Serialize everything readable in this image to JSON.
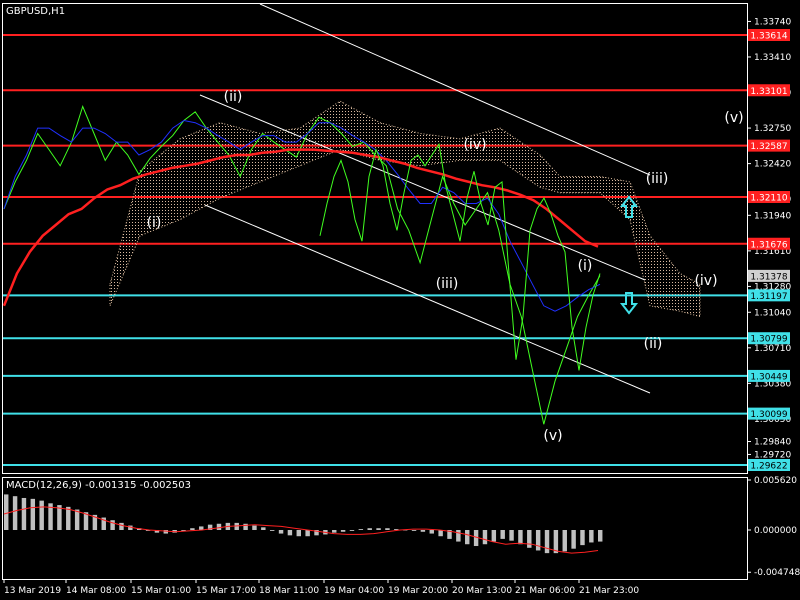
{
  "window": {
    "title": "GBPUSD,H1"
  },
  "chart_data": [
    {
      "type": "line",
      "title": "GBPUSD,H1",
      "ylim": [
        1.2962,
        1.3385
      ],
      "y_ticks": [
        "1.33740",
        "1.33410",
        "1.33080",
        "1.32750",
        "1.32420",
        "1.32090",
        "1.31940",
        "1.31610",
        "1.31280",
        "1.31040",
        "1.30710",
        "1.30380",
        "1.30050",
        "1.29720",
        "1.29840"
      ],
      "y_tick_values": [
        1.3374,
        1.3341,
        1.3308,
        1.3275,
        1.3242,
        1.3209,
        1.3194,
        1.3161,
        1.3128,
        1.3104,
        1.3071,
        1.3038,
        1.3005,
        1.2972,
        1.2984
      ],
      "current_price": {
        "label": "1.31378",
        "value": 1.31378
      },
      "resistance_levels": [
        {
          "label": "1.33614",
          "value": 1.33614,
          "color": "#ff2020"
        },
        {
          "label": "1.33101",
          "value": 1.33101,
          "color": "#ff2020"
        },
        {
          "label": "1.32587",
          "value": 1.32587,
          "color": "#ff2020"
        },
        {
          "label": "1.32110",
          "value": 1.3211,
          "color": "#ff2020"
        },
        {
          "label": "1.31676",
          "value": 1.31676,
          "color": "#ff2020"
        }
      ],
      "support_levels": [
        {
          "label": "1.31197",
          "value": 1.31197,
          "color": "#40e0e8"
        },
        {
          "label": "1.30799",
          "value": 1.30799,
          "color": "#40e0e8"
        },
        {
          "label": "1.30449",
          "value": 1.30449,
          "color": "#40e0e8"
        },
        {
          "label": "1.30099",
          "value": 1.30099,
          "color": "#40e0e8"
        },
        {
          "label": "1.29622",
          "value": 1.29622,
          "color": "#40e0e8"
        }
      ],
      "series": [
        {
          "values": [
            1.32,
            1.3225,
            1.3245,
            1.327,
            1.3255,
            1.324,
            1.3262,
            1.3295,
            1.327,
            1.3245,
            1.3262,
            1.325,
            1.3232,
            1.3247,
            1.3258,
            1.3268,
            1.3282,
            1.329,
            1.3275,
            1.3262,
            1.325,
            1.323,
            1.3255,
            1.327,
            1.3262,
            1.3255,
            1.3248,
            1.327,
            1.3285,
            1.328,
            1.327,
            1.3258,
            1.3262,
            1.325,
            1.324,
            1.32,
            1.318,
            1.315,
            1.319,
            1.323,
            1.3205,
            1.3185,
            1.32,
            1.3215,
            1.318,
            1.313,
            1.31,
            1.305,
            1.3,
            1.304,
            1.307,
            1.31,
            1.312,
            1.3138
          ],
          "color": "#40ff20"
        },
        {
          "values": [
            1.32,
            1.323,
            1.325,
            1.3275,
            1.3275,
            1.3268,
            1.3262,
            1.3275,
            1.3275,
            1.327,
            1.3262,
            1.3262,
            1.325,
            1.3255,
            1.3262,
            1.3275,
            1.3282,
            1.328,
            1.3275,
            1.3268,
            1.3262,
            1.3255,
            1.3262,
            1.3268,
            1.3268,
            1.3262,
            1.3262,
            1.327,
            1.328,
            1.328,
            1.3275,
            1.3268,
            1.3262,
            1.3255,
            1.3245,
            1.3232,
            1.3218,
            1.3205,
            1.3205,
            1.322,
            1.3215,
            1.3205,
            1.3205,
            1.321,
            1.3195,
            1.317,
            1.315,
            1.313,
            1.311,
            1.3105,
            1.311,
            1.3118,
            1.3125,
            1.313
          ],
          "color": "#2030ff"
        },
        {
          "values": [
            1.311,
            1.314,
            1.316,
            1.3175,
            1.3185,
            1.3195,
            1.32,
            1.321,
            1.3218,
            1.3222,
            1.3228,
            1.3232,
            1.3235,
            1.3238,
            1.324,
            1.3242,
            1.3245,
            1.3248,
            1.325,
            1.325,
            1.3252,
            1.3253,
            1.3255,
            1.3255,
            1.3255,
            1.3254,
            1.3253,
            1.3252,
            1.325,
            1.3248,
            1.3245,
            1.3242,
            1.3238,
            1.3235,
            1.3232,
            1.3228,
            1.3225,
            1.3222,
            1.322,
            1.3217,
            1.3213,
            1.3208,
            1.32,
            1.319,
            1.318,
            1.317,
            1.3165
          ],
          "color": "#ff2020"
        },
        {
          "values": [
            1.3175,
            1.3205,
            1.323,
            1.3245,
            1.3225,
            1.319,
            1.317,
            1.323,
            1.3255,
            1.324,
            1.3205,
            1.318,
            1.3215,
            1.3245,
            1.325,
            1.324,
            1.325,
            1.326,
            1.322,
            1.3195,
            1.317,
            1.321,
            1.3235,
            1.3205,
            1.3185,
            1.322,
            1.3225,
            1.314,
            1.306,
            1.31,
            1.318,
            1.32,
            1.321,
            1.3195,
            1.3175,
            1.316,
            1.309,
            1.305,
            1.309,
            1.312,
            1.314
          ],
          "color": "#40ff20"
        }
      ],
      "ichimoku_cloud": [
        {
          "x": 110,
          "upper": 1.313,
          "lower": 1.311
        },
        {
          "x": 140,
          "upper": 1.3235,
          "lower": 1.3175
        },
        {
          "x": 180,
          "upper": 1.3265,
          "lower": 1.319
        },
        {
          "x": 220,
          "upper": 1.328,
          "lower": 1.321
        },
        {
          "x": 260,
          "upper": 1.327,
          "lower": 1.3225
        },
        {
          "x": 300,
          "upper": 1.3275,
          "lower": 1.324
        },
        {
          "x": 340,
          "upper": 1.33,
          "lower": 1.3255
        },
        {
          "x": 380,
          "upper": 1.328,
          "lower": 1.3245
        },
        {
          "x": 420,
          "upper": 1.327,
          "lower": 1.324
        },
        {
          "x": 460,
          "upper": 1.3265,
          "lower": 1.3245
        },
        {
          "x": 500,
          "upper": 1.3275,
          "lower": 1.3245
        },
        {
          "x": 540,
          "upper": 1.325,
          "lower": 1.322
        },
        {
          "x": 560,
          "upper": 1.323,
          "lower": 1.3215
        },
        {
          "x": 600,
          "upper": 1.323,
          "lower": 1.3215
        },
        {
          "x": 630,
          "upper": 1.3225,
          "lower": 1.319
        },
        {
          "x": 650,
          "upper": 1.3175,
          "lower": 1.311
        },
        {
          "x": 680,
          "upper": 1.314,
          "lower": 1.3105
        },
        {
          "x": 700,
          "upper": 1.313,
          "lower": 1.31
        }
      ],
      "wave_labels": [
        "(ii)",
        "(i)",
        "(iv)",
        "(iii)",
        "(iii)",
        "(iv)",
        "(v)",
        "(i)",
        "(ii)",
        "(v)"
      ],
      "arrows": [
        {
          "direction": "up",
          "color": "#40e0e8"
        },
        {
          "direction": "down",
          "color": "#40e0e8"
        }
      ],
      "x_ticks": [
        "13 Mar 2019",
        "14 Mar 08:00",
        "15 Mar 01:00",
        "15 Mar 17:00",
        "18 Mar 11:00",
        "19 Mar 04:00",
        "19 Mar 20:00",
        "20 Mar 13:00",
        "21 Mar 06:00",
        "21 Mar 23:00"
      ]
    },
    {
      "type": "bar",
      "title": "MACD(12,26,9) -0.001315 -0.002503",
      "ylim": [
        -0.005,
        0.006
      ],
      "y_ticks": [
        "0.005620",
        "0.000000",
        "-0.004748"
      ],
      "y_tick_values": [
        0.00562,
        0.0,
        -0.004748
      ],
      "histogram": [
        0.004,
        0.0038,
        0.0036,
        0.0035,
        0.0033,
        0.003,
        0.0028,
        0.0026,
        0.0023,
        0.002,
        0.0017,
        0.0014,
        0.0011,
        0.0008,
        0.0005,
        0.0002,
        -0.0001,
        -0.0003,
        -0.0004,
        -0.0003,
        -0.0001,
        0.0002,
        0.0004,
        0.0006,
        0.0007,
        0.0008,
        0.0008,
        0.0007,
        0.0005,
        0.0003,
        -0.0001,
        -0.0004,
        -0.0006,
        -0.0007,
        -0.0007,
        -0.0006,
        -0.0005,
        -0.0003,
        -0.0002,
        -0.0001,
        0.0001,
        0.0002,
        0.0002,
        0.0002,
        0.0001,
        0.0,
        -0.0001,
        -0.0002,
        -0.0004,
        -0.0007,
        -0.001,
        -0.0013,
        -0.0016,
        -0.0018,
        -0.0016,
        -0.0013,
        -0.001,
        -0.0012,
        -0.0016,
        -0.002,
        -0.0023,
        -0.0026,
        -0.0026,
        -0.0024,
        -0.0021,
        -0.0017,
        -0.0014,
        -0.0013
      ],
      "signal": [
        0.0018,
        0.0022,
        0.0025,
        0.0026,
        0.0025,
        0.0023,
        0.0019,
        0.0014,
        0.0009,
        0.0005,
        0.0002,
        0.0,
        -0.0001,
        -0.0002,
        -0.0001,
        0.0,
        0.0002,
        0.0004,
        0.0005,
        0.0006,
        0.0005,
        0.0004,
        0.0002,
        0.0,
        -0.0002,
        -0.0004,
        -0.0005,
        -0.0005,
        -0.0004,
        -0.0002,
        0.0,
        0.0001,
        0.0001,
        0.0,
        -0.0002,
        -0.0005,
        -0.0009,
        -0.0013,
        -0.0016,
        -0.0015,
        -0.0016,
        -0.002,
        -0.0024,
        -0.0026,
        -0.0025,
        -0.0023
      ],
      "colors": {
        "histogram": "#c0c0c0",
        "signal": "#ff2020"
      }
    }
  ]
}
